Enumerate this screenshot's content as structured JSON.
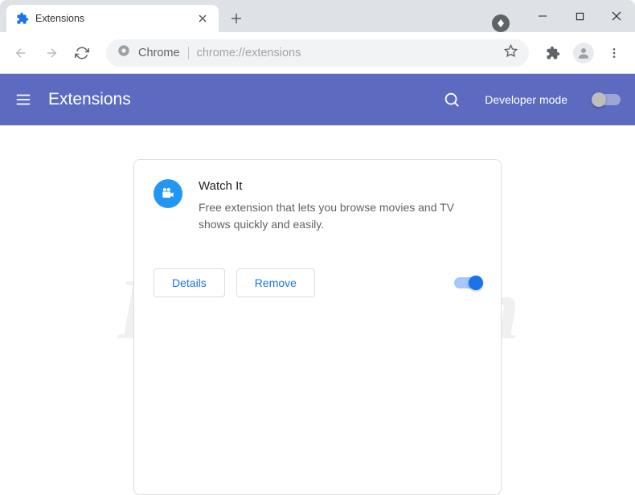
{
  "window": {
    "tab": {
      "title": "Extensions"
    }
  },
  "toolbar": {
    "chrome_prefix": "Chrome",
    "url": "chrome://extensions"
  },
  "header": {
    "title": "Extensions",
    "dev_mode_label": "Developer mode",
    "dev_mode_on": false
  },
  "extension": {
    "name": "Watch It",
    "description": "Free extension that lets you browse movies and TV shows quickly and easily.",
    "details_label": "Details",
    "remove_label": "Remove",
    "enabled": true
  },
  "watermark": "PCrisk.com"
}
